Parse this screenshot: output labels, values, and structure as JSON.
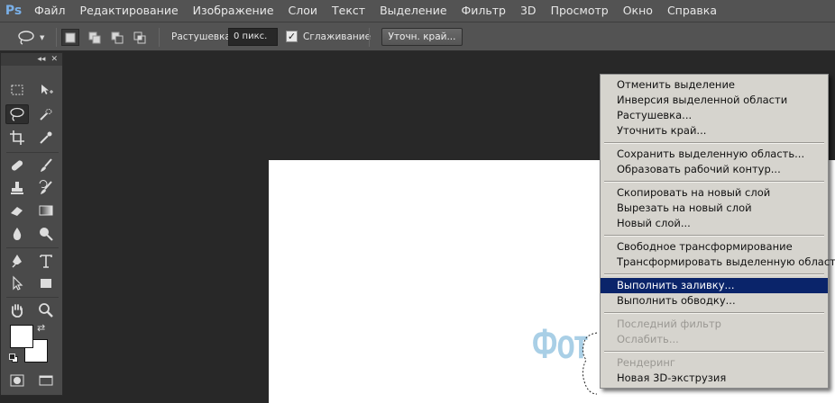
{
  "app": {
    "logo": "Ps"
  },
  "menubar": {
    "items": [
      "Файл",
      "Редактирование",
      "Изображение",
      "Слои",
      "Текст",
      "Выделение",
      "Фильтр",
      "3D",
      "Просмотр",
      "Окно",
      "Справка"
    ]
  },
  "options": {
    "feather_label": "Растушевка:",
    "feather_value": "0 пикс.",
    "antialias_label": "Сглаживание",
    "antialias_checked": true,
    "refine_edge_label": "Уточн. край..."
  },
  "tools_panel": {
    "collapse_glyph": "◂◂",
    "close_glyph": "✕"
  },
  "canvas": {
    "text": "Фот"
  },
  "context_menu": {
    "groups": [
      [
        {
          "label": "Отменить выделение",
          "enabled": true
        },
        {
          "label": "Инверсия выделенной области",
          "enabled": true
        },
        {
          "label": "Растушевка...",
          "enabled": true
        },
        {
          "label": "Уточнить край...",
          "enabled": true
        }
      ],
      [
        {
          "label": "Сохранить выделенную область...",
          "enabled": true
        },
        {
          "label": "Образовать рабочий контур...",
          "enabled": true
        }
      ],
      [
        {
          "label": "Скопировать на новый слой",
          "enabled": true
        },
        {
          "label": "Вырезать на новый слой",
          "enabled": true
        },
        {
          "label": "Новый слой...",
          "enabled": true
        }
      ],
      [
        {
          "label": "Свободное трансформирование",
          "enabled": true
        },
        {
          "label": "Трансформировать выделенную область",
          "enabled": true
        }
      ],
      [
        {
          "label": "Выполнить заливку...",
          "enabled": true,
          "highlighted": true
        },
        {
          "label": "Выполнить обводку...",
          "enabled": true
        }
      ],
      [
        {
          "label": "Последний фильтр",
          "enabled": false
        },
        {
          "label": "Ослабить...",
          "enabled": false
        }
      ],
      [
        {
          "label": "Рендеринг",
          "enabled": false
        },
        {
          "label": "Новая 3D-экструзия",
          "enabled": true
        }
      ]
    ]
  },
  "colors": {
    "app_bg": "#282828",
    "bar_bg": "#535353",
    "menu_bg": "#d6d4ce",
    "menu_highlight": "#0a246a",
    "canvas_text": "#a9cfe6"
  }
}
